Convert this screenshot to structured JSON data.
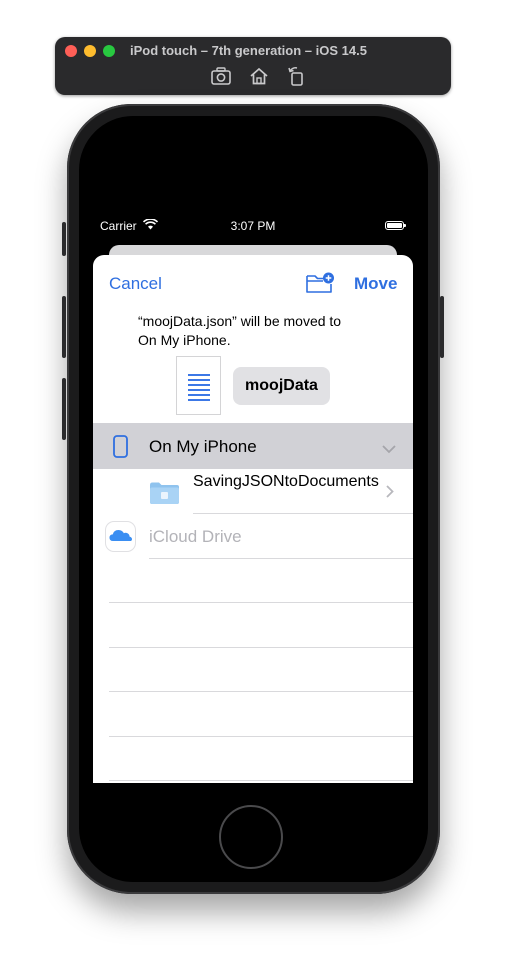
{
  "simulator": {
    "title": "iPod touch – 7th generation – iOS 14.5",
    "tools": [
      "screenshot-icon",
      "home-icon",
      "rotate-icon"
    ]
  },
  "status_bar": {
    "carrier": "Carrier",
    "time": "3:07 PM"
  },
  "sheet": {
    "cancel_label": "Cancel",
    "move_label": "Move",
    "message_line1": "“moojData.json” will be moved to",
    "message_line2": "On My iPhone.",
    "file_name": "moojData"
  },
  "locations": {
    "on_my_iphone": "On My iPhone",
    "folder": "SavingJSONtoDocuments",
    "icloud": "iCloud Drive"
  },
  "colors": {
    "accent": "#2f6fe0",
    "selected_row": "#d1d1d6",
    "disabled_text": "#b3b3b8"
  }
}
